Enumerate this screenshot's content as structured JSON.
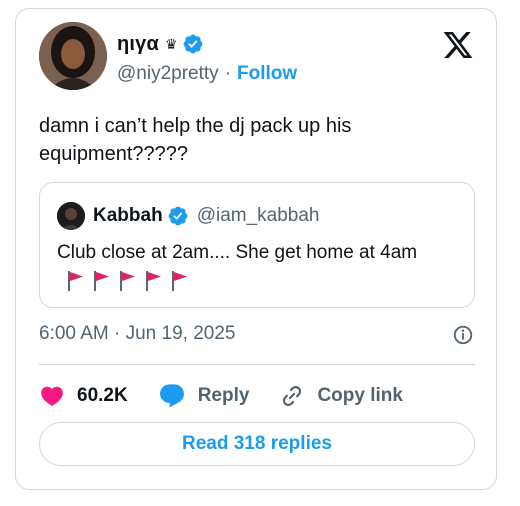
{
  "tweet": {
    "author": {
      "display_name": "ηιγα",
      "crown": "♛",
      "handle": "@niy2pretty",
      "separator": "·",
      "follow_label": "Follow"
    },
    "text": "damn i can’t help the dj pack up his equipment?????",
    "quote": {
      "display_name": "Kabbah",
      "handle": "@iam_kabbah",
      "text": "Club close at 2am.... She get home at 4am",
      "flag_count": 5
    },
    "timestamp": "6:00 AM · Jun 19, 2025",
    "likes": "60.2K",
    "reply_label": "Reply",
    "copy_link_label": "Copy link",
    "read_replies_label": "Read 318 replies"
  },
  "colors": {
    "accent": "#1d9bf0",
    "like": "#f91880",
    "flag": "#e0245e",
    "secondary_text": "#536471",
    "border": "#cfd9de"
  },
  "icons": [
    "x-logo-icon",
    "verified-badge-icon",
    "heart-icon",
    "reply-bubble-icon",
    "link-icon",
    "info-icon",
    "red-flag-icon"
  ]
}
